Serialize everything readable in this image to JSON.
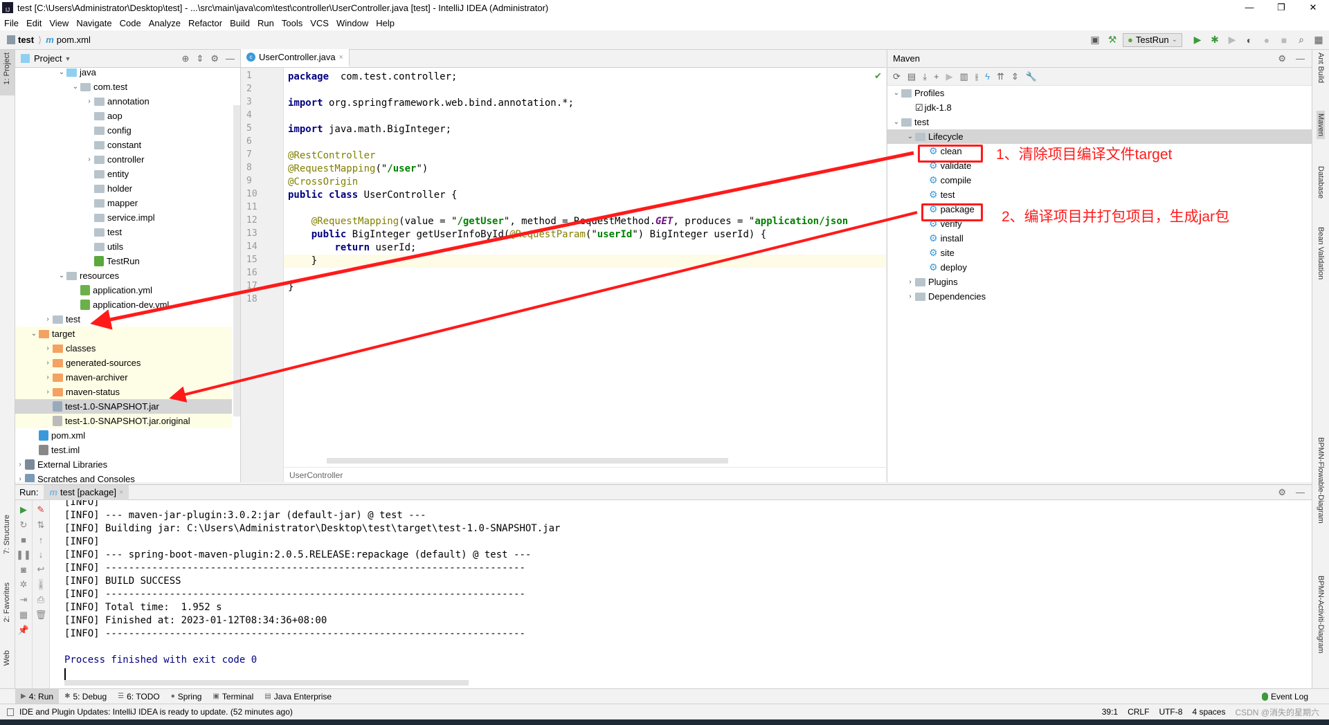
{
  "window": {
    "title": "test [C:\\Users\\Administrator\\Desktop\\test] - ...\\src\\main\\java\\com\\test\\controller\\UserController.java [test] - IntelliJ IDEA (Administrator)",
    "logo": "IJ"
  },
  "menu": [
    "File",
    "Edit",
    "View",
    "Navigate",
    "Code",
    "Analyze",
    "Refactor",
    "Build",
    "Run",
    "Tools",
    "VCS",
    "Window",
    "Help"
  ],
  "nav": {
    "project": "test",
    "file": "pom.xml",
    "run_config": "TestRun"
  },
  "left_stripe": {
    "project": "1: Project",
    "structure": "7: Structure",
    "favorites": "2: Favorites",
    "web": "Web"
  },
  "right_stripe": [
    "Ant Build",
    "Maven",
    "Database",
    "Bean Validation",
    "BPMN-Flowable-Diagram",
    "BPMN-Activiti-Diagram"
  ],
  "project": {
    "title": "Project",
    "tree": [
      {
        "label": "java",
        "level": 2,
        "chev": "down",
        "icon": "folder-blue"
      },
      {
        "label": "com.test",
        "level": 3,
        "chev": "down",
        "icon": "package"
      },
      {
        "label": "annotation",
        "level": 4,
        "chev": "right",
        "icon": "package"
      },
      {
        "label": "aop",
        "level": 4,
        "icon": "package"
      },
      {
        "label": "config",
        "level": 4,
        "icon": "package"
      },
      {
        "label": "constant",
        "level": 4,
        "icon": "package"
      },
      {
        "label": "controller",
        "level": 4,
        "chev": "right",
        "icon": "package"
      },
      {
        "label": "entity",
        "level": 4,
        "icon": "package"
      },
      {
        "label": "holder",
        "level": 4,
        "icon": "package"
      },
      {
        "label": "mapper",
        "level": 4,
        "icon": "package"
      },
      {
        "label": "service.impl",
        "level": 4,
        "icon": "package"
      },
      {
        "label": "test",
        "level": 4,
        "icon": "package"
      },
      {
        "label": "utils",
        "level": 4,
        "icon": "package"
      },
      {
        "label": "TestRun",
        "level": 4,
        "icon": "spring-class"
      },
      {
        "label": "resources",
        "level": 2,
        "chev": "down",
        "icon": "folder-res"
      },
      {
        "label": "application.yml",
        "level": 3,
        "icon": "spring-yml"
      },
      {
        "label": "application-dev.yml",
        "level": 3,
        "icon": "spring-yml"
      },
      {
        "label": "test",
        "level": 1,
        "chev": "right",
        "icon": "folder"
      },
      {
        "label": "target",
        "level": 0,
        "chev": "down",
        "icon": "folder-orange",
        "hl": "yellow"
      },
      {
        "label": "classes",
        "level": 1,
        "chev": "right",
        "icon": "folder-orange",
        "hl": "yellow"
      },
      {
        "label": "generated-sources",
        "level": 1,
        "chev": "right",
        "icon": "folder-orange",
        "hl": "yellow"
      },
      {
        "label": "maven-archiver",
        "level": 1,
        "chev": "right",
        "icon": "folder-orange",
        "hl": "yellow"
      },
      {
        "label": "maven-status",
        "level": 1,
        "chev": "right",
        "icon": "folder-orange",
        "hl": "yellow"
      },
      {
        "label": "test-1.0-SNAPSHOT.jar",
        "level": 1,
        "icon": "jar",
        "hl": "selected"
      },
      {
        "label": "test-1.0-SNAPSHOT.jar.original",
        "level": 1,
        "icon": "file-unknown",
        "hl": "yellow"
      },
      {
        "label": "pom.xml",
        "level": 0,
        "icon": "maven"
      },
      {
        "label": "test.iml",
        "level": 0,
        "icon": "iml"
      },
      {
        "label": "External Libraries",
        "level": -1,
        "chev": "right",
        "icon": "libraries"
      },
      {
        "label": "Scratches and Consoles",
        "level": -1,
        "chev": "right",
        "icon": "scratches"
      }
    ]
  },
  "editor": {
    "tab": "UserController.java",
    "breadcrumb": "UserController",
    "lines": [
      [
        [
          "kw",
          "package"
        ],
        [
          "",
          "  com.test.controller;"
        ]
      ],
      [],
      [
        [
          "kw",
          "import"
        ],
        [
          "",
          " org.springframework.web.bind.annotation.*;"
        ]
      ],
      [],
      [
        [
          "kw",
          "import"
        ],
        [
          "",
          " java.math.BigInteger;"
        ]
      ],
      [],
      [
        [
          "an",
          "@RestController"
        ]
      ],
      [
        [
          "an",
          "@RequestMapping"
        ],
        [
          "",
          "(\""
        ],
        [
          "st",
          "/user"
        ],
        [
          "",
          "\")"
        ]
      ],
      [
        [
          "an",
          "@CrossOrigin"
        ]
      ],
      [
        [
          "kw",
          "public class"
        ],
        [
          "",
          " UserController {"
        ]
      ],
      [],
      [
        [
          "",
          "    "
        ],
        [
          "an",
          "@RequestMapping"
        ],
        [
          "",
          "(value = \""
        ],
        [
          "st",
          "/getUser"
        ],
        [
          "",
          "\", method = RequestMethod."
        ],
        [
          "it",
          "GET"
        ],
        [
          "",
          ", produces = \""
        ],
        [
          "st",
          "application/json"
        ]
      ],
      [
        [
          "",
          "    "
        ],
        [
          "kw",
          "public"
        ],
        [
          "",
          " BigInteger getUserInfoById("
        ],
        [
          "an",
          "@RequestParam"
        ],
        [
          "",
          "(\""
        ],
        [
          "st",
          "userId"
        ],
        [
          "",
          "\") BigInteger userId) {"
        ]
      ],
      [
        [
          "",
          "        "
        ],
        [
          "kw",
          "return"
        ],
        [
          "",
          " userId;"
        ]
      ],
      [
        [
          "",
          "    }"
        ]
      ],
      [],
      [
        [
          "",
          "}"
        ]
      ],
      []
    ]
  },
  "maven": {
    "title": "Maven",
    "tree": [
      {
        "label": "Profiles",
        "level": 0,
        "chev": "down",
        "icon": "profiles"
      },
      {
        "label": "jdk-1.8",
        "level": 1,
        "icon": "checkbox"
      },
      {
        "label": "test",
        "level": 0,
        "chev": "down",
        "icon": "maven-project"
      },
      {
        "label": "Lifecycle",
        "level": 1,
        "chev": "down",
        "icon": "lifecycle",
        "hl": "selected"
      },
      {
        "label": "clean",
        "level": 2,
        "icon": "gear"
      },
      {
        "label": "validate",
        "level": 2,
        "icon": "gear"
      },
      {
        "label": "compile",
        "level": 2,
        "icon": "gear"
      },
      {
        "label": "test",
        "level": 2,
        "icon": "gear"
      },
      {
        "label": "package",
        "level": 2,
        "icon": "gear"
      },
      {
        "label": "verify",
        "level": 2,
        "icon": "gear"
      },
      {
        "label": "install",
        "level": 2,
        "icon": "gear"
      },
      {
        "label": "site",
        "level": 2,
        "icon": "gear"
      },
      {
        "label": "deploy",
        "level": 2,
        "icon": "gear"
      },
      {
        "label": "Plugins",
        "level": 1,
        "chev": "right",
        "icon": "plugins"
      },
      {
        "label": "Dependencies",
        "level": 1,
        "chev": "right",
        "icon": "dependencies"
      }
    ]
  },
  "annotations": {
    "clean_note": "1、清除项目编译文件target",
    "package_note": "2、编译项目并打包项目，生成jar包",
    "color": "#ff1a1a"
  },
  "run": {
    "label": "Run:",
    "tab": "test [package]",
    "console": [
      "[INFO]",
      "[INFO] --- maven-jar-plugin:3.0.2:jar (default-jar) @ test ---",
      "[INFO] Building jar: C:\\Users\\Administrator\\Desktop\\test\\target\\test-1.0-SNAPSHOT.jar",
      "[INFO]",
      "[INFO] --- spring-boot-maven-plugin:2.0.5.RELEASE:repackage (default) @ test ---",
      "[INFO] ------------------------------------------------------------------------",
      "[INFO] BUILD SUCCESS",
      "[INFO] ------------------------------------------------------------------------",
      "[INFO] Total time:  1.952 s",
      "[INFO] Finished at: 2023-01-12T08:34:36+08:00",
      "[INFO] ------------------------------------------------------------------------",
      "",
      "Process finished with exit code 0"
    ]
  },
  "bottom_tabs": [
    "4: Run",
    "5: Debug",
    "6: TODO",
    "Spring",
    "Terminal",
    "Java Enterprise"
  ],
  "event_log": "Event Log",
  "status": {
    "message": "IDE and Plugin Updates: IntelliJ IDEA is ready to update. (52 minutes ago)",
    "position": "39:1",
    "line_sep": "CRLF",
    "encoding": "UTF-8",
    "indent": "4 spaces"
  },
  "watermark": "CSDN @消失的星期六"
}
